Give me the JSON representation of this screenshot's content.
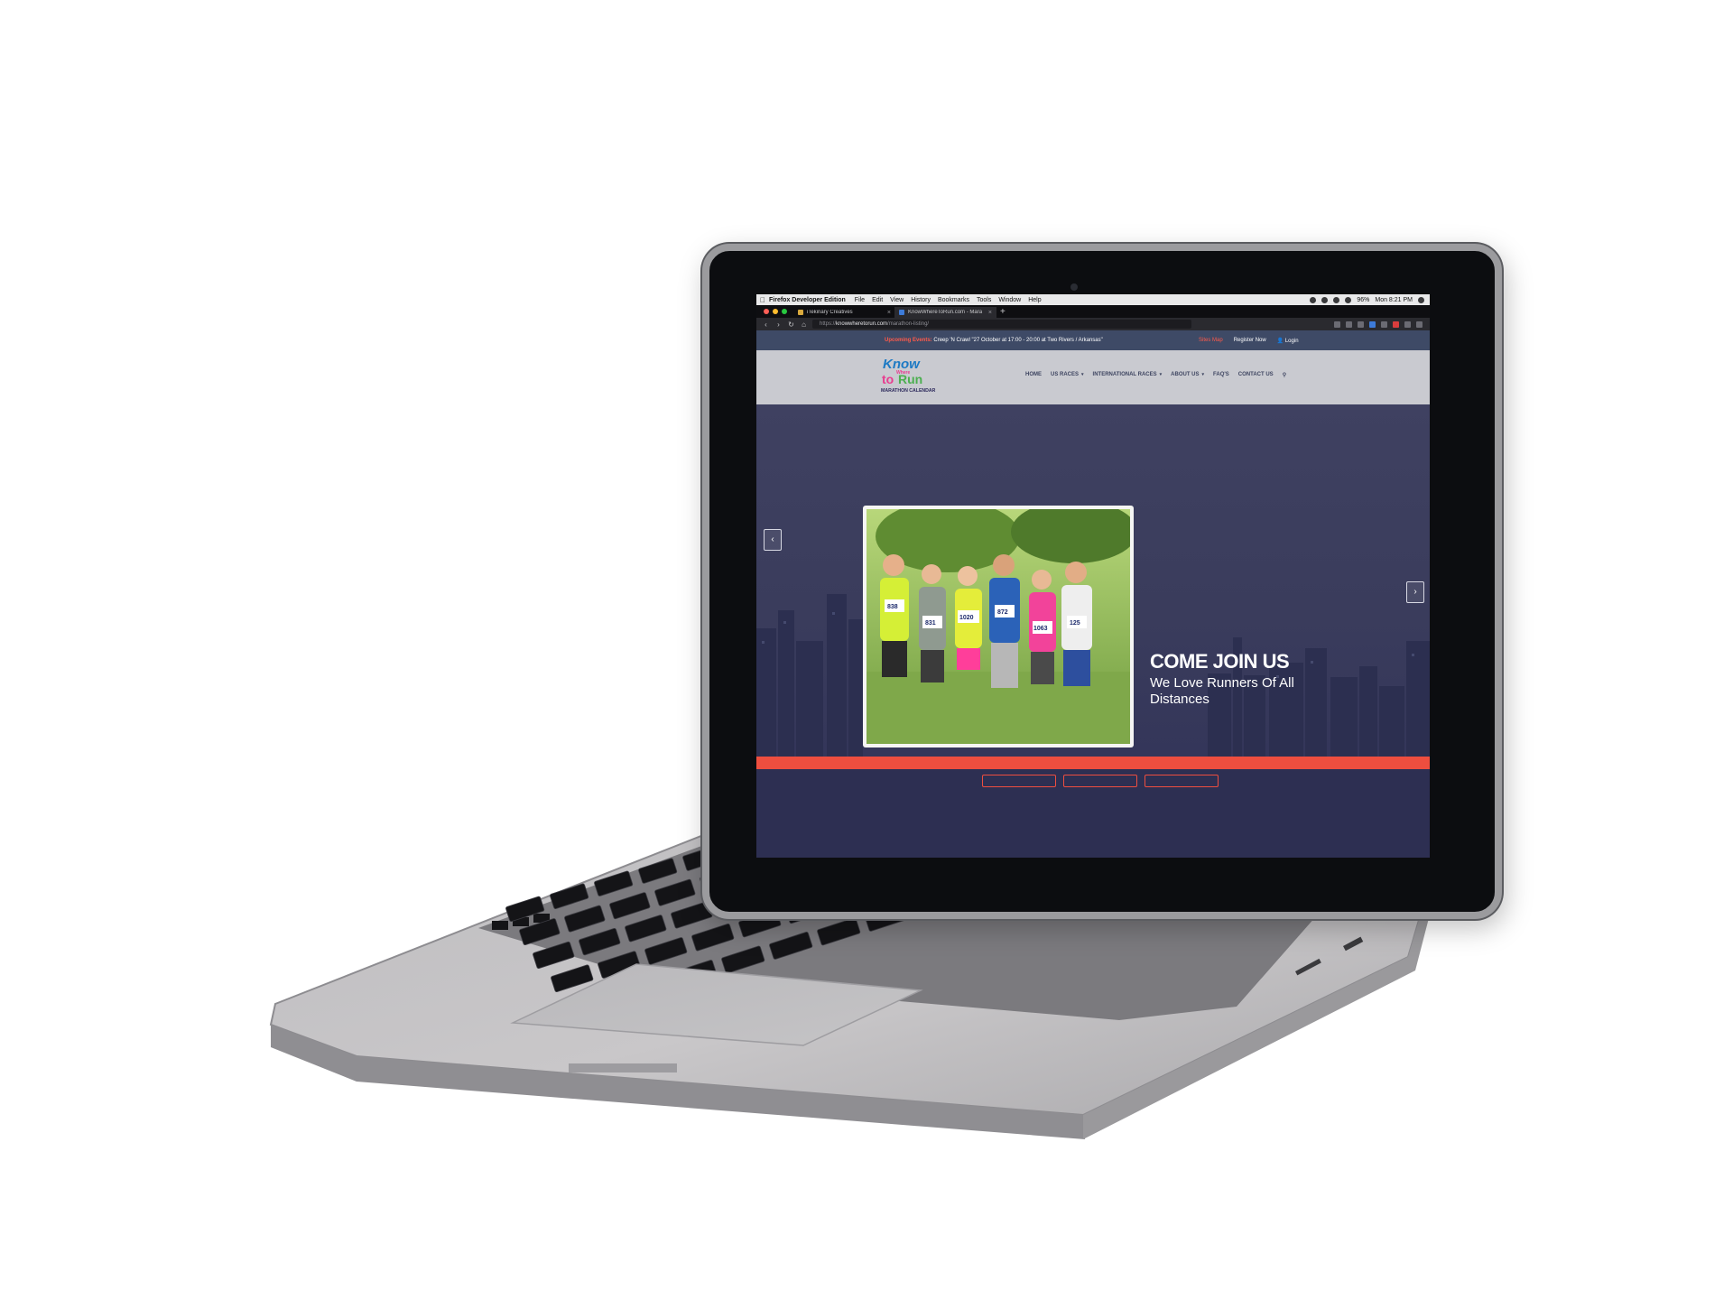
{
  "mac_menubar": {
    "app_name": "Firefox Developer Edition",
    "menus": [
      "File",
      "Edit",
      "View",
      "History",
      "Bookmarks",
      "Tools",
      "Window",
      "Help"
    ],
    "battery": "96%",
    "clock": "Mon 8:21 PM"
  },
  "browser": {
    "tabs": [
      {
        "label": "iTekinary Creatives",
        "active": false
      },
      {
        "label": "KnowWhereToRun.com - Mara",
        "active": true
      }
    ],
    "url_prefix": "https://",
    "url_domain": "knowwheretorun.com",
    "url_path": "/marathon-listing/"
  },
  "announcement": {
    "label": "Upcoming Events:",
    "text": "Creep 'N Crawl \"27 October at 17:00 - 20:00 at Two Rivers / Arkansas\"",
    "links": {
      "sitemap": "Sites Map",
      "register": "Register Now",
      "login": "Login"
    }
  },
  "header": {
    "logo_lines": [
      "Know",
      "Where",
      "to",
      "Run",
      "MARATHON CALENDAR"
    ],
    "nav": [
      {
        "label": "HOME",
        "dropdown": false
      },
      {
        "label": "US RACES",
        "dropdown": true
      },
      {
        "label": "INTERNATIONAL RACES",
        "dropdown": true
      },
      {
        "label": "ABOUT US",
        "dropdown": true
      },
      {
        "label": "FAQ'S",
        "dropdown": false
      },
      {
        "label": "CONTACT US",
        "dropdown": false
      }
    ]
  },
  "hero": {
    "title": "COME JOIN US",
    "subtitle": "We Love Runners Of All Distances",
    "prev_icon": "chevron-left-icon",
    "next_icon": "chevron-right-icon",
    "bibs": [
      "838",
      "831",
      "1020",
      "872",
      "1063",
      "125"
    ]
  },
  "colors": {
    "accent": "#ee4e3f",
    "hero_bg": "#3a3c5c",
    "header_bg": "#c9cad0",
    "nav_text": "#3d4460"
  }
}
